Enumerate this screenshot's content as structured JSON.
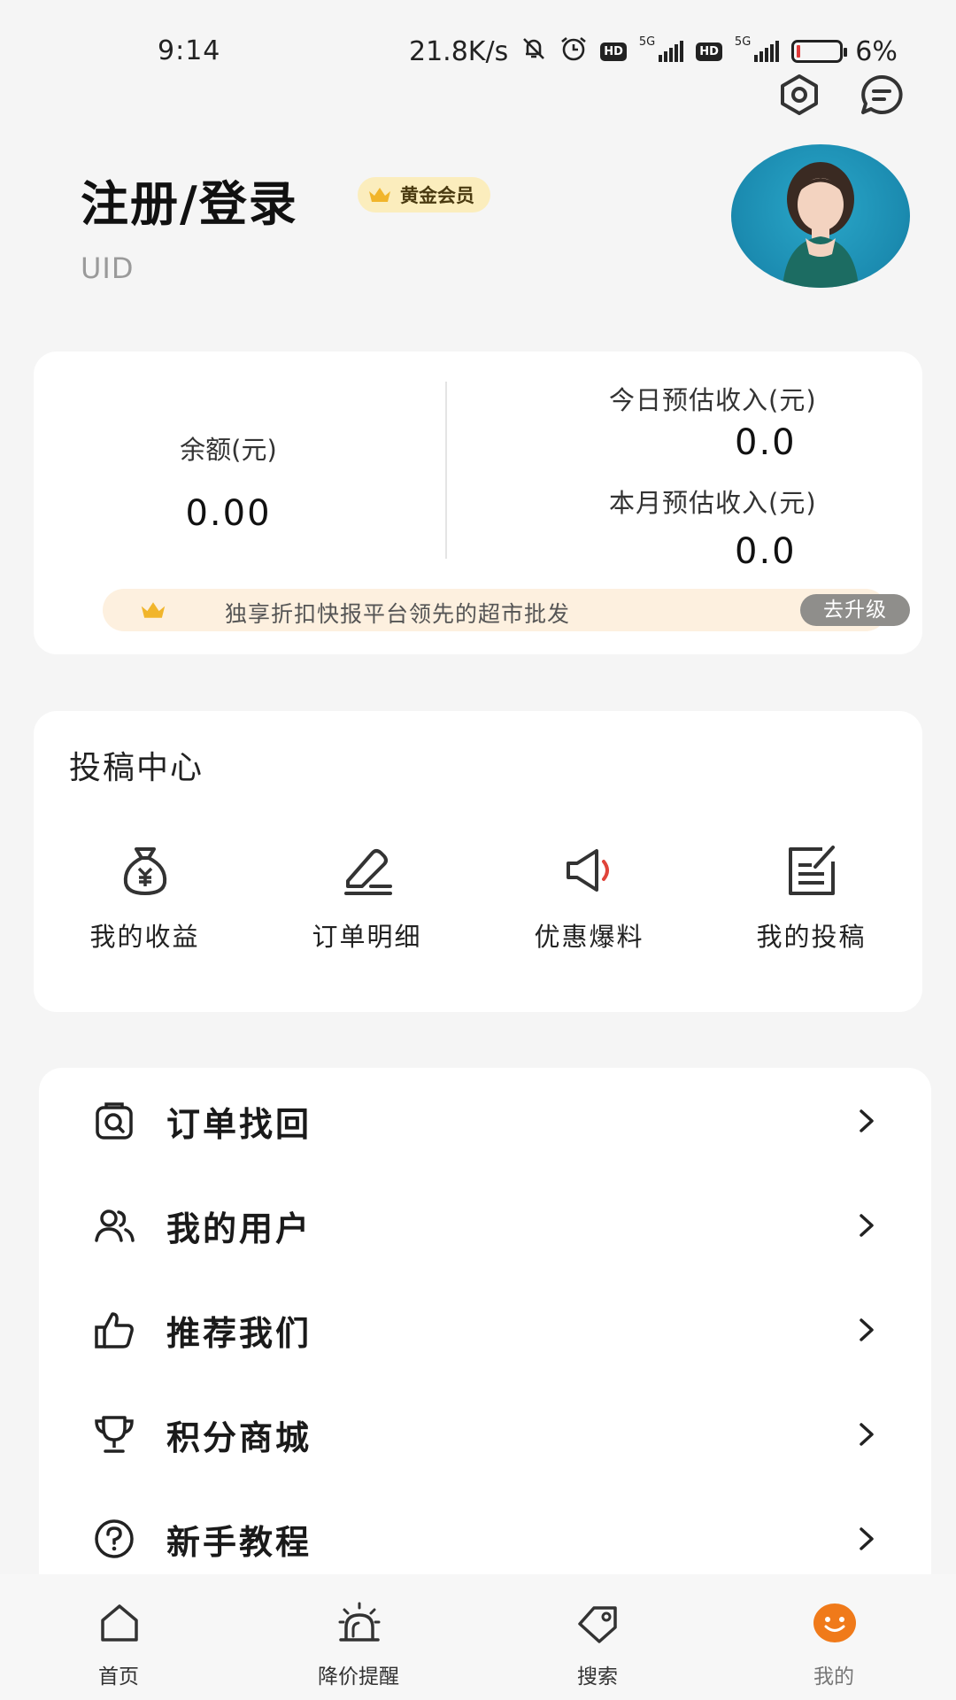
{
  "status_bar": {
    "time": "9:14",
    "speed": "21.8K/s",
    "hd1": "HD",
    "net1": "5G",
    "hd2": "HD",
    "net2": "5G",
    "battery": "6%",
    "battery_level": 0.06
  },
  "profile": {
    "title": "注册/登录",
    "vip_badge": "黄金会员",
    "uid_label": "UID"
  },
  "earnings": {
    "balance_label": "余额(元)",
    "balance_value": "0.00",
    "today_label": "今日预估收入(元)",
    "today_value": "0.0",
    "month_label": "本月预估收入(元)",
    "month_value": "0.0",
    "promo_text": "独享折扣快报平台领先的超市批发",
    "upgrade_label": "去升级"
  },
  "submission_center": {
    "title": "投稿中心",
    "items": [
      {
        "label": "我的收益",
        "icon": "money-bag-icon"
      },
      {
        "label": "订单明细",
        "icon": "edit-pen-icon"
      },
      {
        "label": "优惠爆料",
        "icon": "megaphone-icon"
      },
      {
        "label": "我的投稿",
        "icon": "document-edit-icon"
      }
    ]
  },
  "menu": {
    "items": [
      {
        "label": "订单找回",
        "icon": "order-search-icon"
      },
      {
        "label": "我的用户",
        "icon": "users-icon"
      },
      {
        "label": "推荐我们",
        "icon": "thumbs-up-icon"
      },
      {
        "label": "积分商城",
        "icon": "trophy-icon"
      },
      {
        "label": "新手教程",
        "icon": "help-icon"
      }
    ]
  },
  "tab_bar": {
    "items": [
      {
        "label": "首页",
        "icon": "home-icon"
      },
      {
        "label": "降价提醒",
        "icon": "alarm-icon"
      },
      {
        "label": "搜索",
        "icon": "tag-icon"
      },
      {
        "label": "我的",
        "icon": "smiley-icon"
      }
    ],
    "active_color": "#f07a1a"
  },
  "colors": {
    "background": "#f5f5f5",
    "vip_badge_bg": "#fbedbd",
    "crown": "#f1b52b",
    "promo_bg": "#fdf0df",
    "upgrade_bg": "#8f8e8b",
    "megaphone_accent": "#e0443a"
  }
}
